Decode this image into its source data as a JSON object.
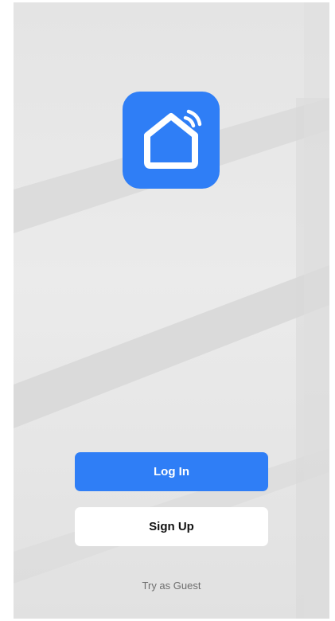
{
  "colors": {
    "brand": "#2f7ef6",
    "background": "#e6e6e6"
  },
  "logo": {
    "icon": "smart-home-icon"
  },
  "actions": {
    "login_label": "Log In",
    "signup_label": "Sign Up",
    "guest_label": "Try as Guest"
  }
}
